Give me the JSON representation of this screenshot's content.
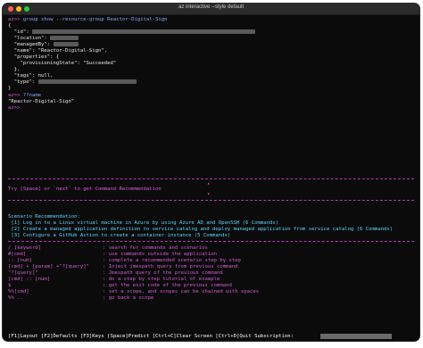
{
  "window": {
    "title": "az interactive --style default",
    "close": "close",
    "minimize": "minimize",
    "zoom": "zoom"
  },
  "prompt": "az>>",
  "cmd1": "group show --resource-group Reactor-Digital-Sign",
  "json": {
    "open": "{",
    "id_key": "  \"id\": ",
    "location_key": "  \"location\": ",
    "managedby_key": "  \"managedBy\": ",
    "name_line": "  \"name\": \"Reactor-Digital-Sign\",",
    "props_open": "  \"properties\": {",
    "prov_line": "    \"provisioningState\": \"Succeeded\"",
    "props_close": "  },",
    "tags_line": "  \"tags\": null,",
    "type_key": "  \"type\": ",
    "close": "}"
  },
  "cmd2": "??name",
  "result2": "\"Reactor-Digital-Sign\"",
  "hint": "Try [Space] or `next` to get Command Recommendation",
  "scenario": {
    "header": "Scenario Recommendation:",
    "items": [
      " [1] Log in to a Linux virtual machine in Azure by using Azure AD and OpenSSH (6 Commands)",
      " [2] Create a managed application definition to service catalog and deploy managed application from service catalog (6 Commands)",
      " [3] Configure a GitHub Action to create a container instance (5 Commands)"
    ]
  },
  "help": [
    {
      "cmd": "/ [keyword]",
      "desc": ": search for commands and scenarios"
    },
    {
      "cmd": "#[cmd]",
      "desc": ": use commands outside the application"
    },
    {
      "cmd": ":: [num]",
      "desc": ": complete a recommended scenario step by step"
    },
    {
      "cmd": "[cmd] + [param] +\"?[query]\"",
      "desc": ": Inject jmespath query from previous command"
    },
    {
      "cmd": "\"?[query]\"",
      "desc": ": Jmespath query of the previous command"
    },
    {
      "cmd": "[cmd] :: [num]",
      "desc": ": do a step by step tutorial of example"
    },
    {
      "cmd": "$",
      "desc": ": get the exit code of the previous command"
    },
    {
      "cmd": "%%[cmd]",
      "desc": ": set a scope, and scopes can be chained with spaces"
    },
    {
      "cmd": "%% ..",
      "desc": ": go back a scope"
    }
  ],
  "status_bar": "[F1]Layout [F2]Defaults [F3]Keys [Space]Predict [Ctrl+C]Clear Screen [Ctrl+D]Quit Subscription: "
}
